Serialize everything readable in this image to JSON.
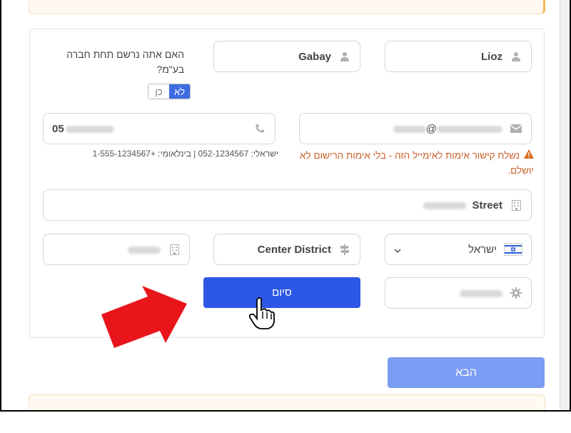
{
  "form": {
    "first_name": "Lioz",
    "last_name": "Gabay",
    "company_question": "האם אתה נרשם תחת חברה בע\"מ?",
    "toggle": {
      "no": "לא",
      "yes": "כן",
      "selected": "no"
    },
    "email_at": "@",
    "phone_prefix": "05",
    "phone_hint": "ישראלי: 052-1234567 | בינלאומי: +1-555-1234567",
    "email_warning": "נשלח קישור אימות לאימייל הזה - בלי אימות הרישום לא יושלם.",
    "street_suffix": "Street",
    "country": "ישראל",
    "district": "Center District",
    "finish_label": "סיום",
    "next_label": "הבא"
  },
  "icons": {
    "first_name": "user-icon",
    "last_name": "user-icon",
    "email": "envelope-icon",
    "phone": "phone-icon",
    "street": "building-icon",
    "city": "building-icon",
    "district": "signpost-icon",
    "country": "israel-flag-icon",
    "zip": "gear-icon"
  },
  "colors": {
    "primary_button": "#2d57e6",
    "next_button": "#7b9df3",
    "warning": "#c9602a",
    "toggle_active": "#3d6be0",
    "annotation_arrow": "#e8151b"
  }
}
